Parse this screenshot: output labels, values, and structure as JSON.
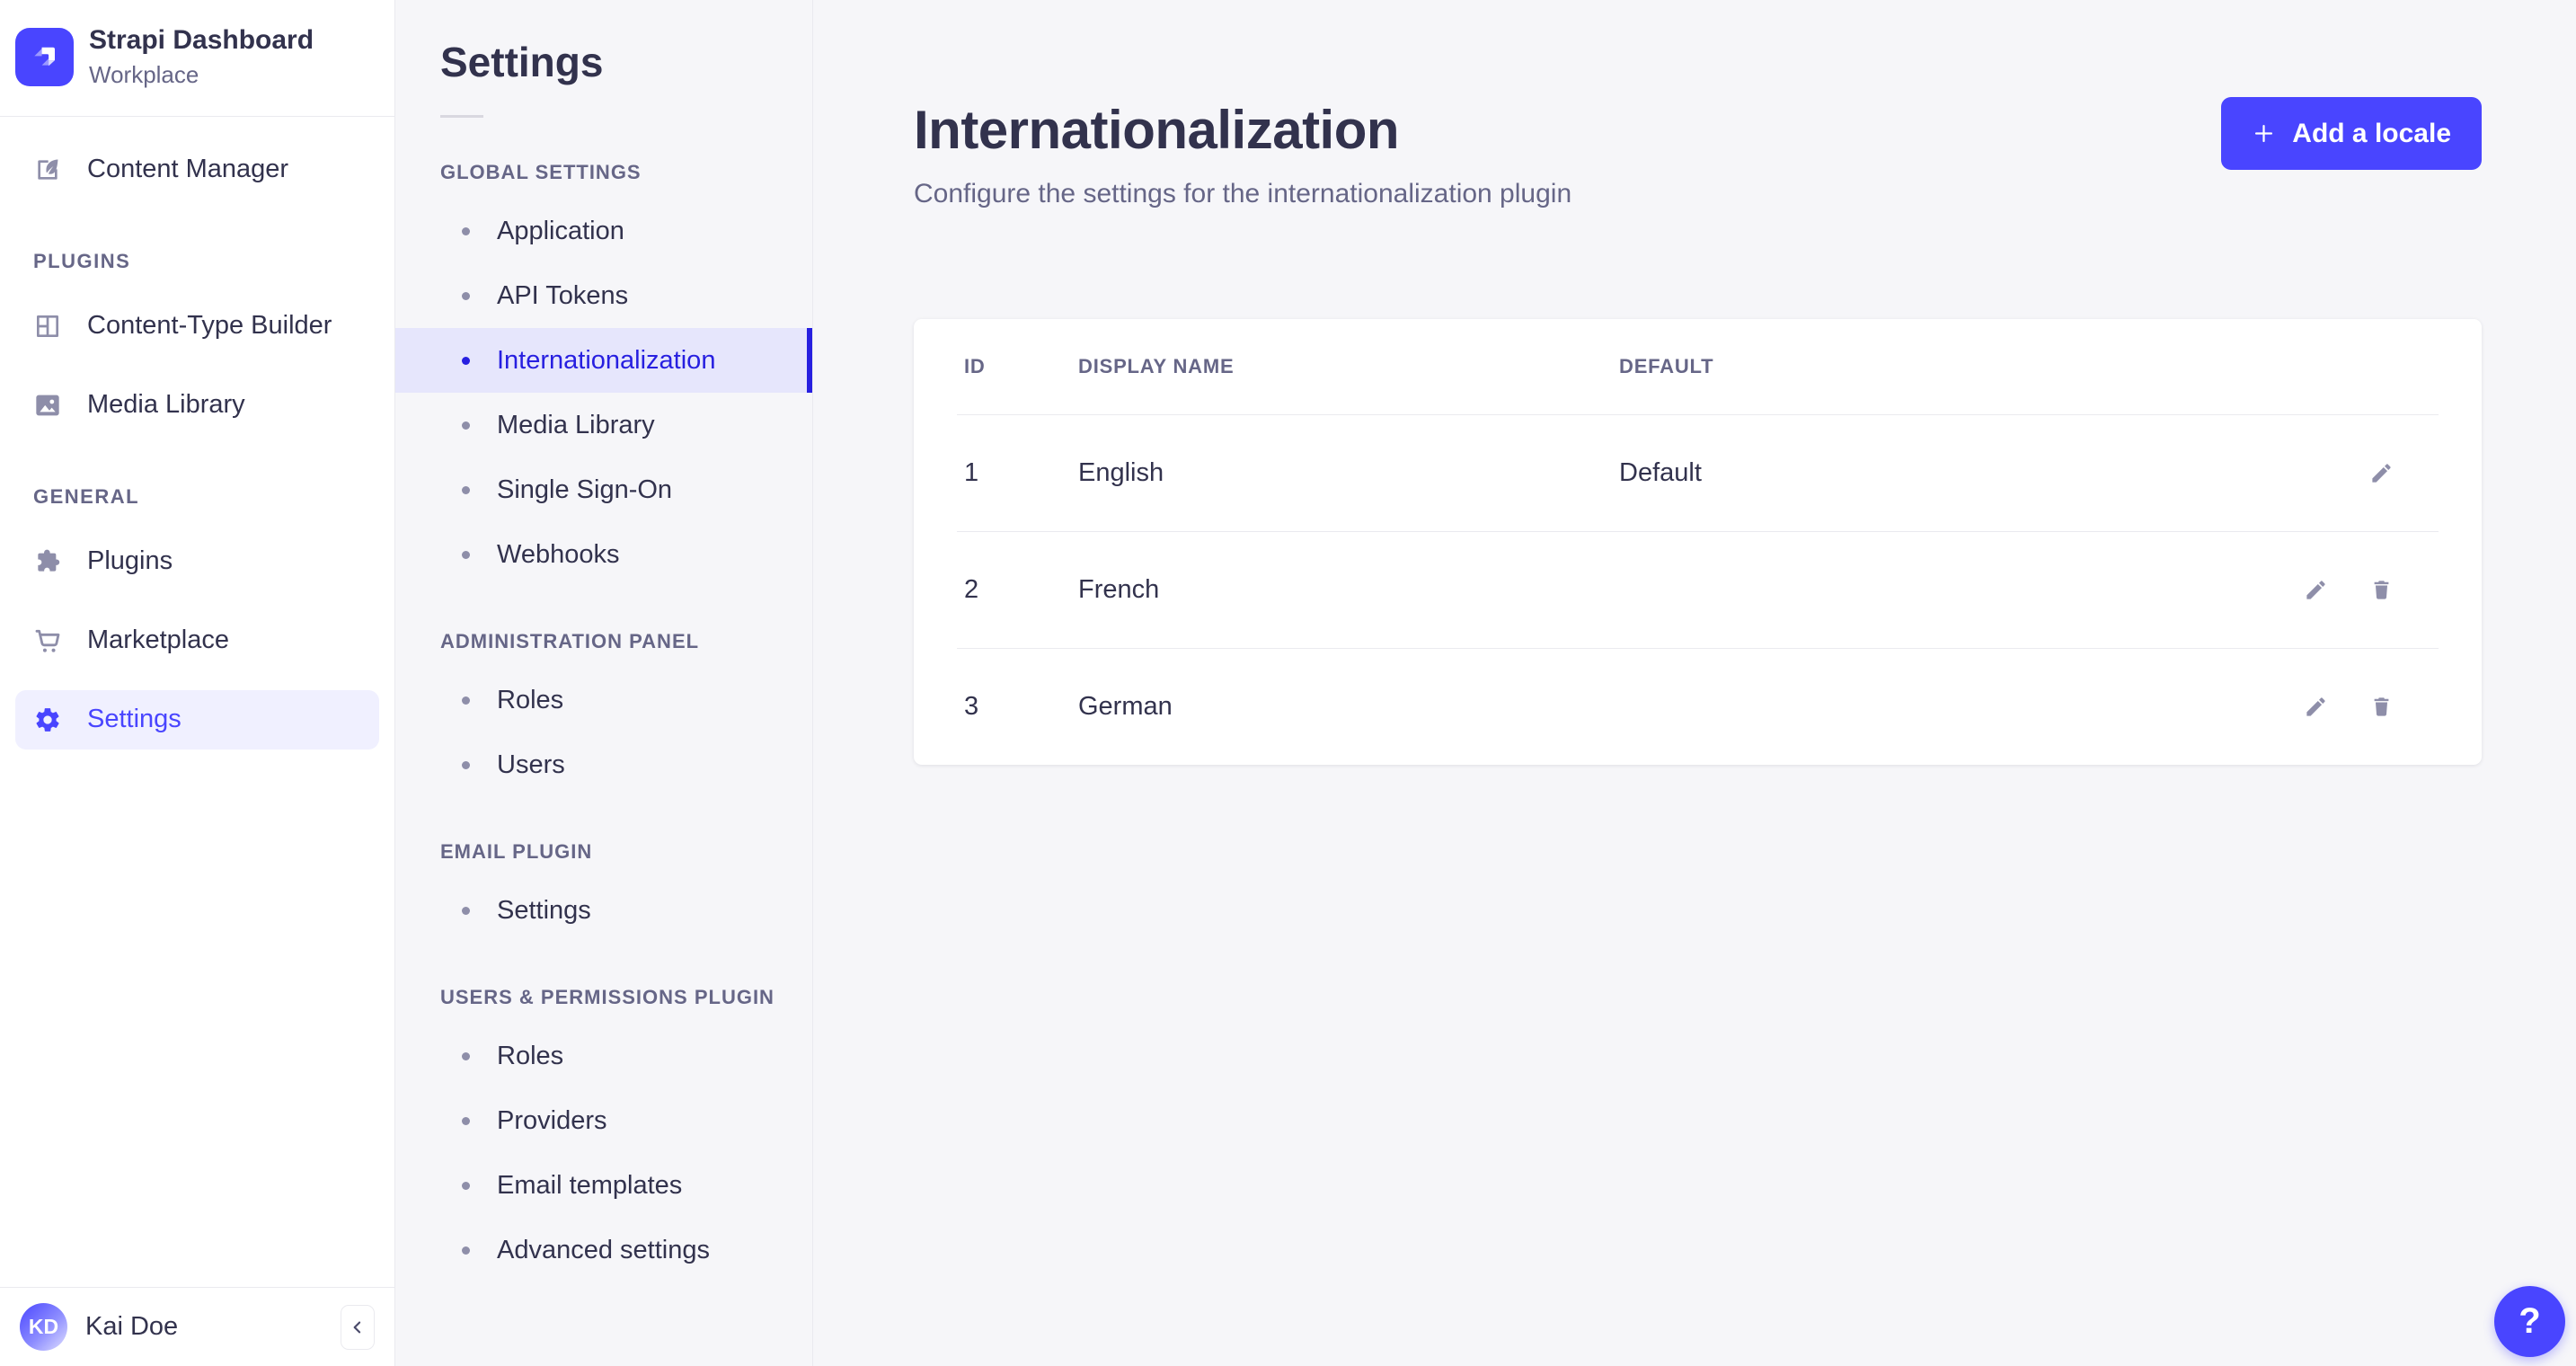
{
  "brand": {
    "name": "Strapi Dashboard",
    "workplace": "Workplace"
  },
  "colors": {
    "primary": "#4945ff",
    "primary_dark": "#271fe0",
    "nav_active_bg": "#f0f0ff",
    "subnav_active_bg": "#e6e6fc",
    "page_bg": "#f6f6f9",
    "border": "#eaeaef",
    "text_dark": "#32324d",
    "text_muted": "#666687",
    "icon_muted": "#8e8ea9"
  },
  "main_nav": {
    "section_labels": {
      "plugins": "PLUGINS",
      "general": "GENERAL"
    },
    "items": {
      "content_manager": "Content Manager",
      "content_type_builder": "Content-Type Builder",
      "media_library": "Media Library",
      "plugins": "Plugins",
      "marketplace": "Marketplace",
      "settings": "Settings"
    },
    "active_item": "Settings"
  },
  "sub_nav": {
    "title": "Settings",
    "global_settings": {
      "label": "GLOBAL SETTINGS",
      "items": [
        "Application",
        "API Tokens",
        "Internationalization",
        "Media Library",
        "Single Sign-On",
        "Webhooks"
      ]
    },
    "administration_panel": {
      "label": "ADMINISTRATION PANEL",
      "items": [
        "Roles",
        "Users"
      ]
    },
    "email_plugin": {
      "label": "EMAIL PLUGIN",
      "items": [
        "Settings"
      ]
    },
    "users_permissions": {
      "label": "USERS & PERMISSIONS PLUGIN",
      "items": [
        "Roles",
        "Providers",
        "Email templates",
        "Advanced settings"
      ]
    },
    "active_item": "Internationalization"
  },
  "page": {
    "title": "Internationalization",
    "subtitle": "Configure the settings for the internationalization plugin",
    "add_locale_button": "Add a locale"
  },
  "table": {
    "headers": {
      "id": "ID",
      "display_name": "DISPLAY NAME",
      "default": "DEFAULT"
    },
    "rows": [
      {
        "id": "1",
        "display_name": "English",
        "default": "Default"
      },
      {
        "id": "2",
        "display_name": "French",
        "default": ""
      },
      {
        "id": "3",
        "display_name": "German",
        "default": ""
      }
    ]
  },
  "footer": {
    "user_initials": "KD",
    "user_name": "Kai Doe"
  },
  "help": {
    "label": "?"
  }
}
